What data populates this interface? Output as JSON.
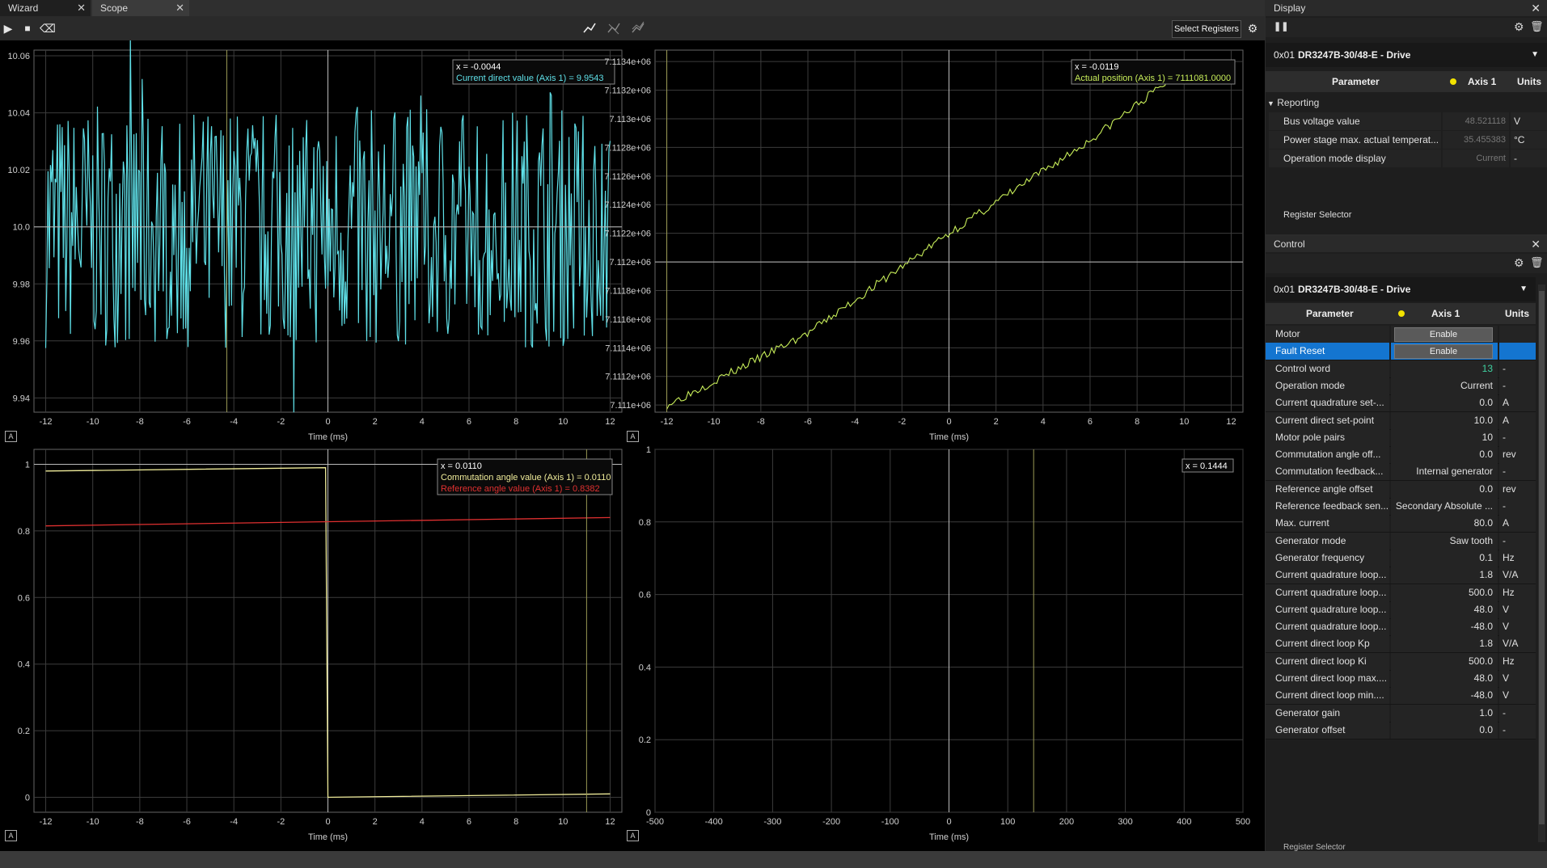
{
  "tabs": [
    {
      "label": "Wizard"
    },
    {
      "label": "Scope"
    }
  ],
  "toolbar": {
    "select_registers": "Select Registers"
  },
  "plots": [
    {
      "xlabel": "Time (ms)",
      "xticks": [
        "-12",
        "-10",
        "-8",
        "-6",
        "-4",
        "-2",
        "0",
        "2",
        "4",
        "6",
        "8",
        "10",
        "12"
      ],
      "yticks": [
        "9.94",
        "9.96",
        "9.98",
        "10.0",
        "10.02",
        "10.04",
        "10.06"
      ],
      "tooltip": {
        "x": "x = -0.0044",
        "lines": [
          "Current direct value (Axis 1) = 9.9543"
        ]
      }
    },
    {
      "xlabel": "Time (ms)",
      "xticks": [
        "-12",
        "-10",
        "-8",
        "-6",
        "-4",
        "-2",
        "0",
        "2",
        "4",
        "6",
        "8",
        "10",
        "12"
      ],
      "yticks": [
        "7.111e+06",
        "7.1112e+06",
        "7.1114e+06",
        "7.1116e+06",
        "7.1118e+06",
        "7.112e+06",
        "7.1122e+06",
        "7.1124e+06",
        "7.1126e+06",
        "7.1128e+06",
        "7.113e+06",
        "7.1132e+06",
        "7.1134e+06"
      ],
      "tooltip": {
        "x": "x = -0.0119",
        "lines": [
          "Actual position (Axis 1) = 7111081.0000"
        ]
      }
    },
    {
      "xlabel": "Time (ms)",
      "xticks": [
        "-12",
        "-10",
        "-8",
        "-6",
        "-4",
        "-2",
        "0",
        "2",
        "4",
        "6",
        "8",
        "10",
        "12"
      ],
      "yticks": [
        "0",
        "0.2",
        "0.4",
        "0.6",
        "0.8",
        "1"
      ],
      "tooltip": {
        "x": "x = 0.0110",
        "lines": [
          "Commutation angle value (Axis 1) = 0.0110",
          "Reference angle value (Axis 1) = 0.8382"
        ]
      }
    },
    {
      "xlabel": "Time (ms)",
      "xticks": [
        "-500",
        "-400",
        "-300",
        "-200",
        "-100",
        "0",
        "100",
        "200",
        "300",
        "400",
        "500"
      ],
      "yticks": [
        "0",
        "0.2",
        "0.4",
        "0.6",
        "0.8",
        "1"
      ],
      "tooltip": {
        "x": "x = 0.1444",
        "lines": []
      }
    }
  ],
  "chart_data": [
    {
      "type": "line",
      "series": [
        {
          "name": "Current direct value (Axis 1)",
          "color": "#5fe0e8",
          "approx": "noise around 10.0, range 9.94-10.04"
        }
      ],
      "xlim": [
        -12.5,
        12.5
      ],
      "ylim": [
        9.935,
        10.062
      ]
    },
    {
      "type": "line",
      "series": [
        {
          "name": "Actual position (Axis 1)",
          "color": "#c8ee5a",
          "x": [
            -12,
            -6,
            0,
            6,
            10
          ],
          "y": [
            7111000,
            7111500,
            7112200,
            7112850,
            7113350
          ]
        }
      ],
      "xlim": [
        -12.5,
        12.5
      ],
      "ylim": [
        7110950,
        7113480
      ]
    },
    {
      "type": "line",
      "series": [
        {
          "name": "Commutation angle value (Axis 1)",
          "color": "#f0ec9a",
          "x": [
            -12,
            -0.1,
            0,
            12
          ],
          "y": [
            0.98,
            0.99,
            0.0,
            0.01
          ]
        },
        {
          "name": "Reference angle value (Axis 1)",
          "color": "#e03030",
          "x": [
            -12,
            12
          ],
          "y": [
            0.815,
            0.84
          ]
        }
      ],
      "xlim": [
        -12.5,
        12.5
      ],
      "ylim": [
        -0.045,
        1.045
      ]
    },
    {
      "type": "line",
      "series": [],
      "xlim": [
        -500,
        500
      ],
      "ylim": [
        0,
        1
      ]
    }
  ],
  "display": {
    "title": "Display",
    "device_addr": "0x01",
    "device_name": "DR3247B-30/48-E - Drive",
    "col_param": "Parameter",
    "col_axis": "Axis 1",
    "col_units": "Units",
    "group": "Reporting",
    "rows": [
      {
        "name": "Bus voltage value",
        "value": "48.521118",
        "unit": "V"
      },
      {
        "name": "Power stage max. actual temperat...",
        "value": "35.455383",
        "unit": "°C"
      },
      {
        "name": "Operation mode display",
        "value": "Current",
        "unit": "-"
      }
    ],
    "register_selector": "Register Selector"
  },
  "control": {
    "title": "Control",
    "device_addr": "0x01",
    "device_name": "DR3247B-30/48-E - Drive",
    "col_param": "Parameter",
    "col_axis": "Axis 1",
    "col_units": "Units",
    "rows": [
      {
        "name": "Motor",
        "value": "Enable",
        "unit": "",
        "button": true
      },
      {
        "name": "Fault Reset",
        "value": "Enable",
        "unit": "",
        "button": true
      },
      {
        "name": "Control word",
        "value": "13",
        "unit": "-"
      },
      {
        "name": "Operation mode",
        "value": "Current",
        "unit": "-"
      },
      {
        "name": "Current quadrature set-...",
        "value": "0.0",
        "unit": "A"
      },
      {
        "name": "Current direct set-point",
        "value": "10.0",
        "unit": "A"
      },
      {
        "name": "Motor pole pairs",
        "value": "10",
        "unit": "-"
      },
      {
        "name": "Commutation angle off...",
        "value": "0.0",
        "unit": "rev"
      },
      {
        "name": "Commutation feedback...",
        "value": "Internal generator",
        "unit": "-"
      },
      {
        "name": "Reference angle offset",
        "value": "0.0",
        "unit": "rev"
      },
      {
        "name": "Reference feedback sen...",
        "value": "Secondary Absolute ...",
        "unit": "-"
      },
      {
        "name": "Max. current",
        "value": "80.0",
        "unit": "A"
      },
      {
        "name": "Generator mode",
        "value": "Saw tooth",
        "unit": "-"
      },
      {
        "name": "Generator frequency",
        "value": "0.1",
        "unit": "Hz"
      },
      {
        "name": "Current quadrature loop...",
        "value": "1.8",
        "unit": "V/A"
      },
      {
        "name": "Current quadrature loop...",
        "value": "500.0",
        "unit": "Hz"
      },
      {
        "name": "Current quadrature loop...",
        "value": "48.0",
        "unit": "V"
      },
      {
        "name": "Current quadrature loop...",
        "value": "-48.0",
        "unit": "V"
      },
      {
        "name": "Current direct loop Kp",
        "value": "1.8",
        "unit": "V/A"
      },
      {
        "name": "Current direct loop Ki",
        "value": "500.0",
        "unit": "Hz"
      },
      {
        "name": "Current direct loop max....",
        "value": "48.0",
        "unit": "V"
      },
      {
        "name": "Current direct loop min....",
        "value": "-48.0",
        "unit": "V"
      },
      {
        "name": "Generator gain",
        "value": "1.0",
        "unit": "-"
      },
      {
        "name": "Generator offset",
        "value": "0.0",
        "unit": "-"
      }
    ],
    "register_selector": "Register Selector"
  }
}
